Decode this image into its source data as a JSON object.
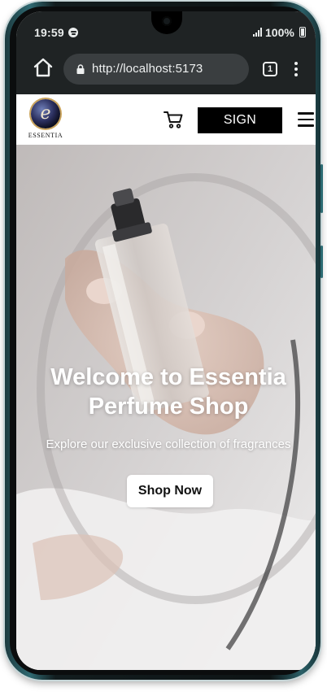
{
  "status_bar": {
    "time": "19:59",
    "battery": "100%",
    "icons": [
      "spotify-icon",
      "signal-icon",
      "battery-icon"
    ]
  },
  "browser": {
    "url": "http://localhost:5173",
    "tab_count": "1",
    "icons": [
      "home-icon",
      "lock-icon",
      "tabs-icon",
      "menu-dots-icon"
    ]
  },
  "header": {
    "logo_text": "ESSENTIA",
    "logo_mark": "e",
    "sign_label": "SIGN",
    "icons": [
      "cart-icon",
      "hamburger-icon"
    ]
  },
  "hero": {
    "title": "Welcome to Essentia Perfume Shop",
    "subtitle": "Explore our exclusive collection of fragrances",
    "cta_label": "Shop Now"
  },
  "colors": {
    "header_bg": "#ffffff",
    "browser_bg": "#1f2324",
    "sign_button_bg": "#000000",
    "cta_bg": "#ffffff"
  }
}
